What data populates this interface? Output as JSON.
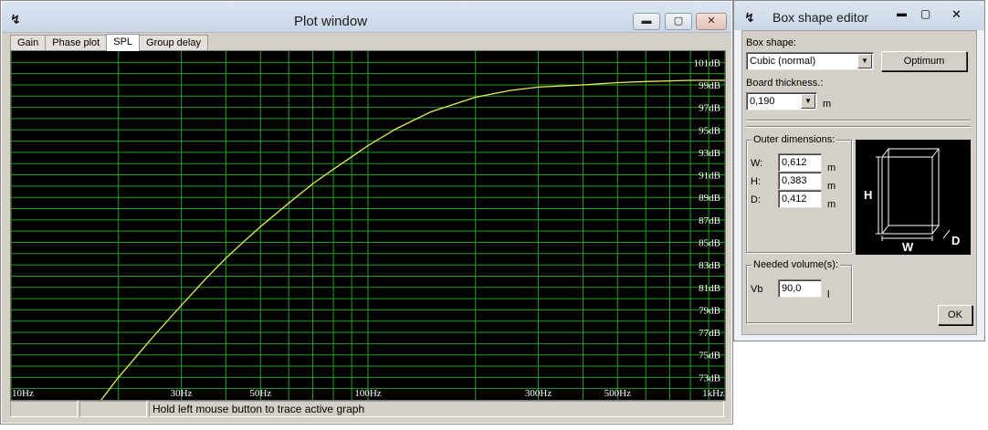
{
  "plot_window": {
    "title": "Plot window",
    "controls": {
      "minimize": "▬",
      "maximize": "▢",
      "close": "✕"
    },
    "tabs": [
      {
        "label": "Gain",
        "active": false
      },
      {
        "label": "Phase plot",
        "active": false
      },
      {
        "label": "SPL",
        "active": true
      },
      {
        "label": "Group delay",
        "active": false
      }
    ],
    "status": {
      "cell1": "",
      "cell2": "",
      "hint": "Hold left mouse button to trace active graph"
    }
  },
  "chart_data": {
    "type": "line",
    "title": "",
    "xlabel": "",
    "ylabel": "",
    "x_scale": "log",
    "xlim": [
      10,
      1000
    ],
    "ylim": [
      71,
      102
    ],
    "x_tick_labels": [
      {
        "value": 10,
        "label": "10Hz"
      },
      {
        "value": 30,
        "label": "30Hz"
      },
      {
        "value": 50,
        "label": "50Hz"
      },
      {
        "value": 100,
        "label": "100Hz"
      },
      {
        "value": 300,
        "label": "300Hz"
      },
      {
        "value": 500,
        "label": "500Hz"
      },
      {
        "value": 1000,
        "label": "1kHz"
      }
    ],
    "y_tick_labels": [
      {
        "value": 101,
        "label": "101dB"
      },
      {
        "value": 99,
        "label": "99dB"
      },
      {
        "value": 97,
        "label": "97dB"
      },
      {
        "value": 95,
        "label": "95dB"
      },
      {
        "value": 93,
        "label": "93dB"
      },
      {
        "value": 91,
        "label": "91dB"
      },
      {
        "value": 89,
        "label": "89dB"
      },
      {
        "value": 87,
        "label": "87dB"
      },
      {
        "value": 85,
        "label": "85dB"
      },
      {
        "value": 83,
        "label": "83dB"
      },
      {
        "value": 81,
        "label": "81dB"
      },
      {
        "value": 79,
        "label": "79dB"
      },
      {
        "value": 77,
        "label": "77dB"
      },
      {
        "value": 75,
        "label": "75dB"
      },
      {
        "value": 73,
        "label": "73dB"
      }
    ],
    "x_grid": [
      10,
      20,
      30,
      40,
      50,
      60,
      70,
      80,
      90,
      100,
      200,
      300,
      400,
      500,
      600,
      700,
      800,
      900,
      1000
    ],
    "y_grid_step": 1,
    "grid": true,
    "colors": {
      "background": "#000000",
      "grid": "#1fa01f",
      "curve": "#e8ef5a",
      "label": "#ffffff"
    },
    "series": [
      {
        "x": [
          17.9,
          20,
          25,
          30,
          35,
          40,
          45,
          50,
          60,
          70,
          80,
          90,
          100,
          120,
          150,
          200,
          250,
          300,
          400,
          500,
          600,
          800,
          1000
        ],
        "y": [
          71.0,
          73.0,
          76.6,
          79.4,
          81.7,
          83.6,
          85.1,
          86.4,
          88.5,
          90.2,
          91.5,
          92.6,
          93.6,
          95.1,
          96.6,
          97.9,
          98.5,
          98.8,
          99.0,
          99.2,
          99.3,
          99.4,
          99.4
        ]
      }
    ]
  },
  "box_editor": {
    "title": "Box shape editor",
    "controls": {
      "minimize": "▬",
      "maximize": "▢",
      "close": "✕"
    },
    "box_shape_label": "Box shape:",
    "box_shape_value": "Cubic (normal)",
    "optimum_button": "Optimum",
    "board_thickness_label": "Board thickness.:",
    "board_thickness_value": "0,190",
    "board_thickness_unit": "m",
    "outer_dimensions_label": "Outer dimensions:",
    "w_label": "W:",
    "w_value": "0,612",
    "w_unit": "m",
    "h_label": "H:",
    "h_value": "0,383",
    "h_unit": "m",
    "d_label": "D:",
    "d_value": "0,412",
    "d_unit": "m",
    "preview_labels": {
      "h": "H",
      "w": "W",
      "d": "D"
    },
    "needed_volume_label": "Needed volume(s):",
    "vb_label": "Vb",
    "vb_value": "90,0",
    "vb_unit": "l",
    "ok_button": "OK"
  }
}
